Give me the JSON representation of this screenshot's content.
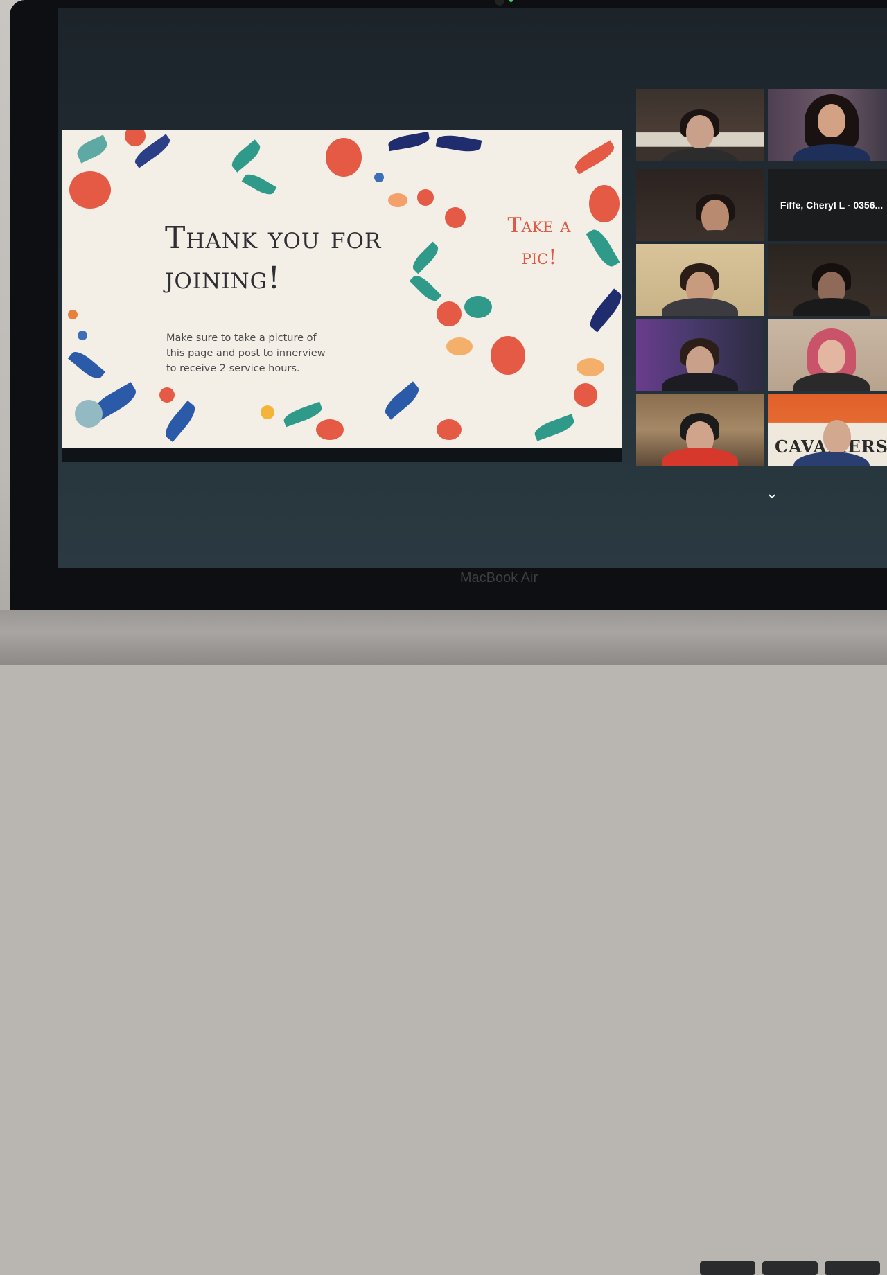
{
  "device": {
    "brand_label": "MacBook Air"
  },
  "slide": {
    "title_line1": "Thank you for",
    "title_line2": "joining!",
    "body": "Make sure to take a picture of this page and post to innerview to receive 2 service hours.",
    "callout_line1": "Take a",
    "callout_line2": "pic!"
  },
  "gallery": {
    "participants": [
      {
        "id": "p1",
        "active": true
      },
      {
        "id": "p2"
      },
      {
        "id": "p3"
      },
      {
        "id": "p4",
        "name": "Fiffe, Cheryl L - 0356..."
      },
      {
        "id": "p5"
      },
      {
        "id": "p6"
      },
      {
        "id": "p7"
      },
      {
        "id": "p8"
      },
      {
        "id": "p9"
      },
      {
        "id": "p10",
        "banner_text": "CAVALIERS"
      }
    ],
    "next_page_icon": "chevron-down-icon"
  },
  "colors": {
    "accent_active_border": "#c8e83a",
    "callout_red": "#e05846",
    "slide_background": "#f3efe6"
  }
}
